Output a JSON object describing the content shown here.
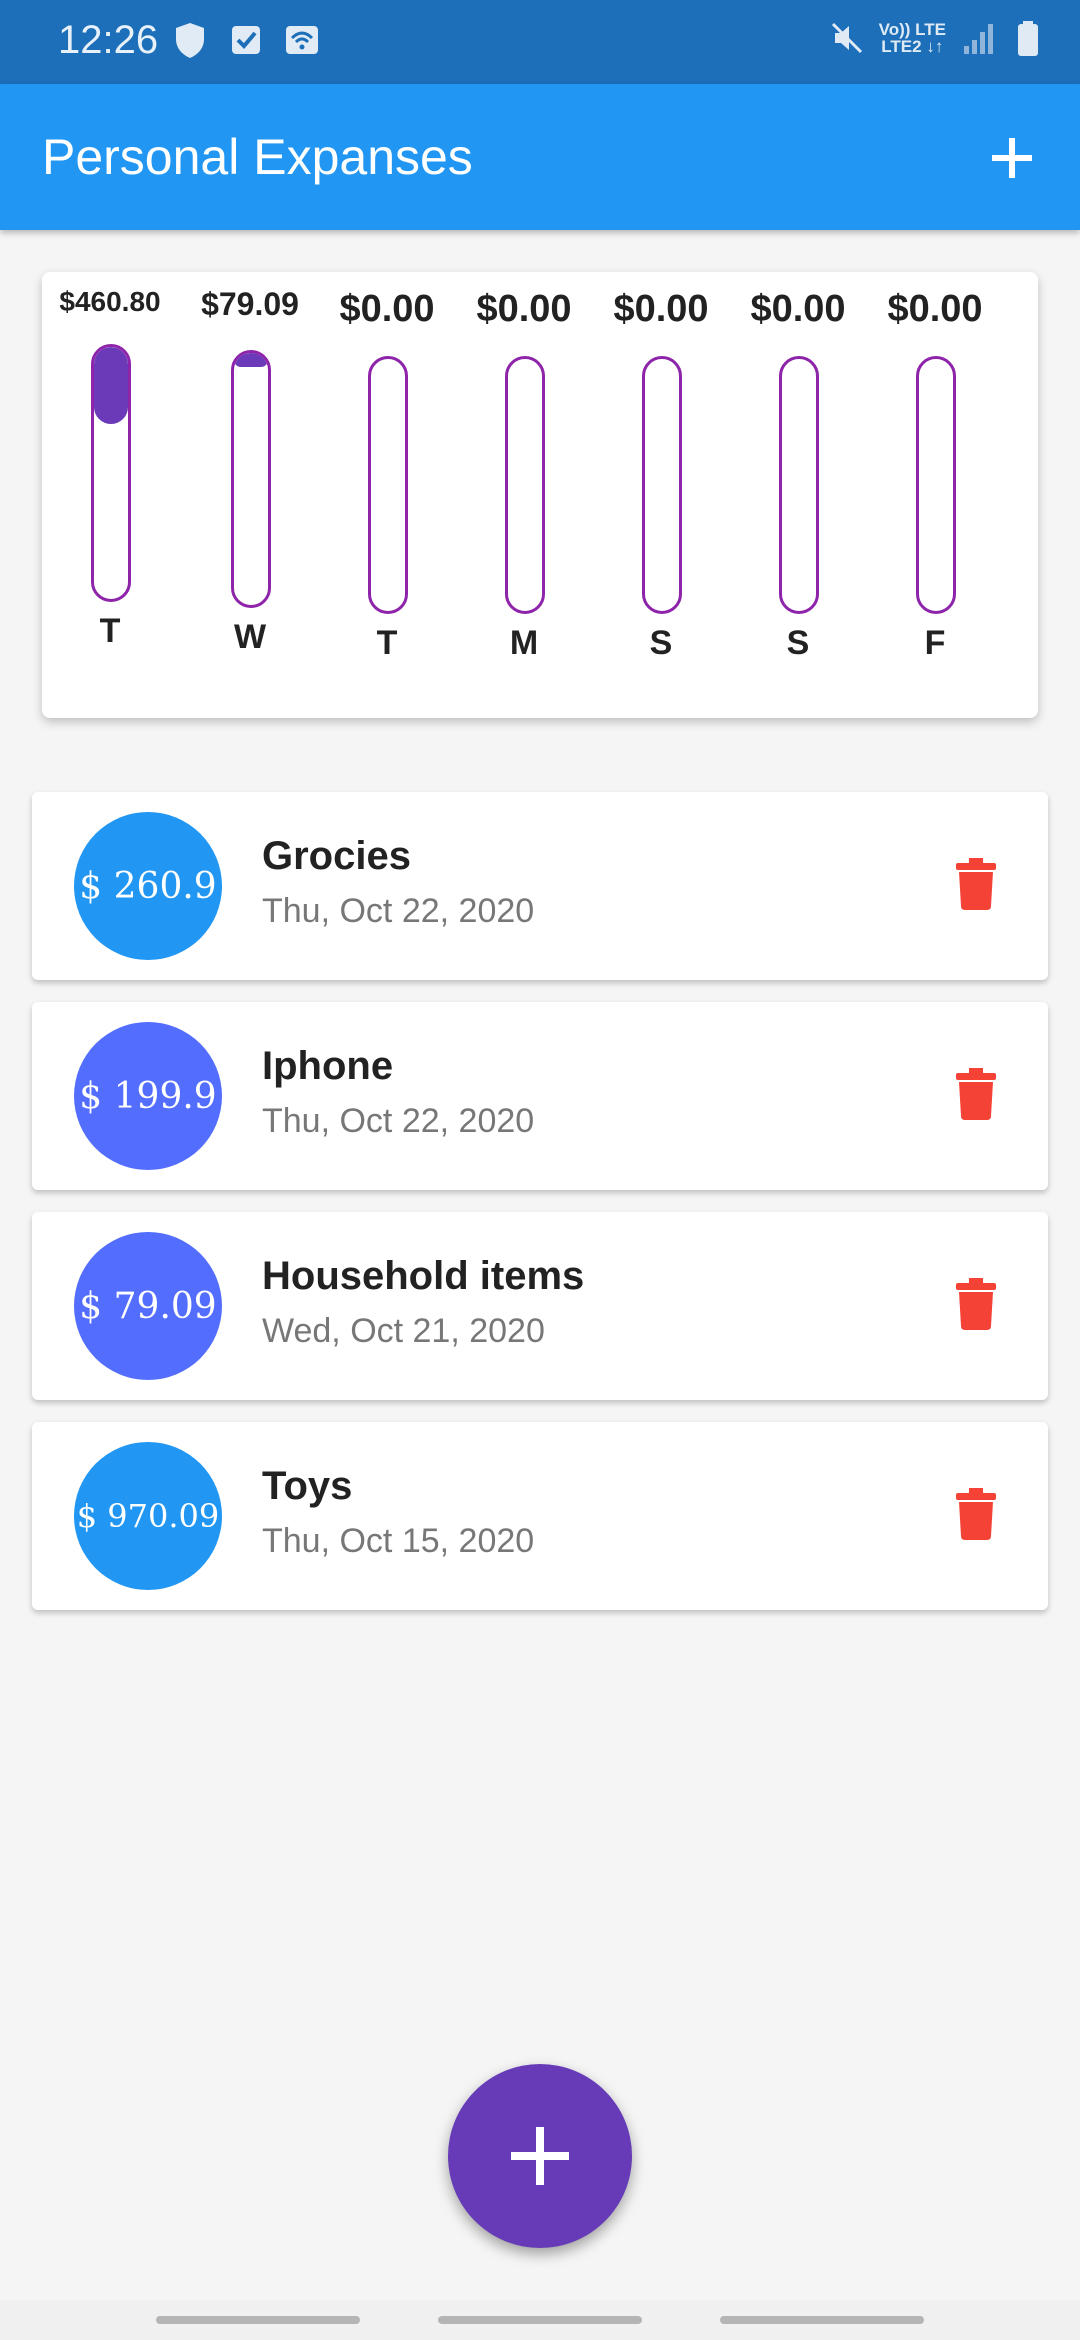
{
  "status_bar": {
    "time": "12:26",
    "left_icons": [
      "shield-icon",
      "checkbox-icon",
      "wifi-calling-icon"
    ],
    "network_line1": "Vo)) LTE",
    "network_line2": "LTE2 ↓↑",
    "right_icons": [
      "mute-icon",
      "signal-icon",
      "battery-icon"
    ]
  },
  "app_bar": {
    "title": "Personal Expanses",
    "action_icon": "plus-icon"
  },
  "chart_data": {
    "type": "bar",
    "categories": [
      "T",
      "W",
      "T",
      "M",
      "S",
      "S",
      "F"
    ],
    "amount_labels": [
      "$460.80",
      "$79.09",
      "$0.00",
      "$0.00",
      "$0.00",
      "$0.00",
      "$0.00"
    ],
    "values": [
      460.8,
      79.09,
      0,
      0,
      0,
      0,
      0
    ],
    "colors": {
      "fill": "#6a3ab8",
      "track_border": "#8e24aa"
    }
  },
  "transactions": [
    {
      "amount": "$ 260.9",
      "title": "Grocies",
      "date": "Thu, Oct 22, 2020",
      "color": "#2196f3"
    },
    {
      "amount": "$ 199.9",
      "title": "Iphone",
      "date": "Thu, Oct 22, 2020",
      "color": "#536dfe"
    },
    {
      "amount": "$ 79.09",
      "title": "Household items",
      "date": "Wed, Oct 21, 2020",
      "color": "#536dfe"
    },
    {
      "amount": "$ 970.09",
      "title": "Toys",
      "date": "Thu, Oct 15, 2020",
      "color": "#2196f3"
    }
  ],
  "colors": {
    "primary": "#2196f3",
    "status_bar": "#1c6fb8",
    "accent": "#673ab7",
    "delete": "#f44336"
  },
  "fab": {
    "icon": "plus-icon"
  }
}
